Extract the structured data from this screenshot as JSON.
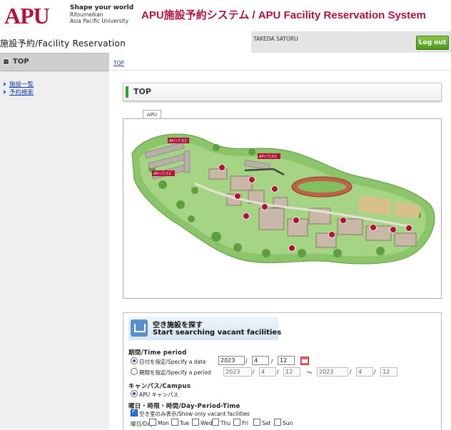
{
  "header": {
    "logo": "APU",
    "tag_line1": "Shape your world",
    "tag_line2": "Ritsumeikan",
    "tag_line3": "Asia Pacific University",
    "system_title": "APU施設予約システム / APU Facility Reservation System"
  },
  "bar": {
    "title": "施設予約/Facility Reservation",
    "user_name": "TAKEDA SATORU",
    "logout_label": "Log out"
  },
  "sidebar": {
    "heading": "TOP",
    "links": [
      {
        "label": "施設一覧"
      },
      {
        "label": "予約検索"
      }
    ]
  },
  "breadcrumb": "TOP",
  "page_title": "TOP",
  "map_tab": "APU",
  "map_labels": {
    "apu_house_3": "APハウス3",
    "apu_house_1": "APハウス1",
    "apu_house_2": "APハウス2"
  },
  "search": {
    "title_jp": "空き施設を探す",
    "title_en": "Start searching vacant facilities",
    "period_label": "期間/Time period",
    "specify_date_label": "日付を指定/Specify a date",
    "date": {
      "year": "2023",
      "month": "4",
      "day": "12"
    },
    "specify_period_label": "期間を指定/Specify a period",
    "period_from": {
      "year": "2023",
      "month": "4",
      "day": "12"
    },
    "period_to": {
      "year": "2023",
      "month": "4",
      "day": "12"
    },
    "tilde": "～",
    "sep": "/",
    "campus_label": "キャンパス/Campus",
    "campus_option": "APU キャンパス",
    "daytime_label": "曜日・時限・時間/Day-Period-Time",
    "vacant_only_label": "空き室のみ表示/Show only vacant facilities",
    "day_label": "曜日/Day",
    "days": [
      "Mon",
      "Tue",
      "Wed",
      "Thu",
      "Fri",
      "Sat",
      "Sun"
    ]
  },
  "colors": {
    "brand": "#b3123c",
    "logout": "#5aa824",
    "link": "#1a3fb0"
  }
}
